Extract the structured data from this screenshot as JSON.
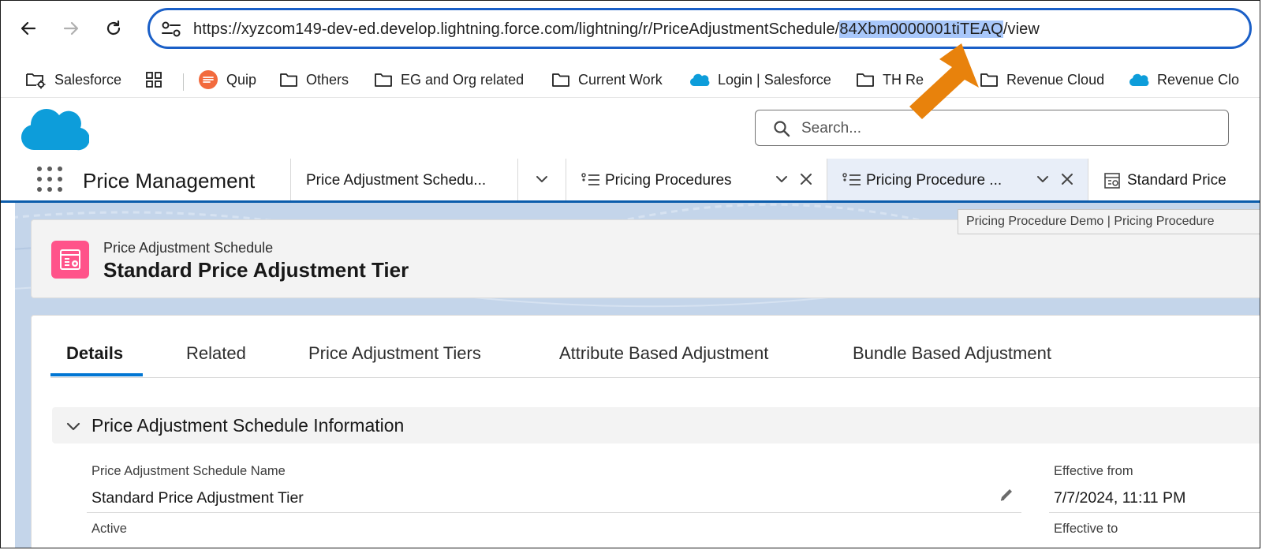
{
  "browser": {
    "url_prefix": "https://xyzcom149-dev-ed.develop.lightning.force.com/lightning/r/PriceAdjustmentSchedule/",
    "url_highlight": "84Xbm0000001tiTEAQ",
    "url_suffix": "/view"
  },
  "bookmarks": [
    {
      "label": "Salesforce",
      "icon": "folder-gear-icon"
    },
    {
      "label": "",
      "icon": "apps-grid-icon"
    },
    {
      "label": "Quip",
      "icon": "quip-icon"
    },
    {
      "label": "Others",
      "icon": "folder-icon"
    },
    {
      "label": "EG and Org related",
      "icon": "folder-icon"
    },
    {
      "label": "Current Work",
      "icon": "folder-icon"
    },
    {
      "label": "Login | Salesforce",
      "icon": "salesforce-cloud-icon"
    },
    {
      "label": "TH Re",
      "icon": "folder-icon"
    },
    {
      "label": "Revenue Cloud",
      "icon": "folder-icon"
    },
    {
      "label": "Revenue Clo",
      "icon": "salesforce-cloud-icon"
    }
  ],
  "header": {
    "search_placeholder": "Search..."
  },
  "app_nav": {
    "app_name": "Price Management",
    "tabs": [
      {
        "label": "Price Adjustment Schedu..."
      },
      {
        "label": "Pricing Procedures"
      },
      {
        "label": "Pricing Procedure ..."
      },
      {
        "label": "Standard Price"
      }
    ],
    "tooltip": "Pricing Procedure Demo | Pricing Procedure"
  },
  "record": {
    "object_type": "Price Adjustment Schedule",
    "title": "Standard Price Adjustment Tier",
    "tabs": [
      "Details",
      "Related",
      "Price Adjustment Tiers",
      "Attribute Based Adjustment",
      "Bundle Based Adjustment"
    ],
    "section_title": "Price Adjustment Schedule Information",
    "fields": {
      "name_label": "Price Adjustment Schedule Name",
      "name_value": "Standard Price Adjustment Tier",
      "active_label": "Active",
      "effective_from_label": "Effective from",
      "effective_from_value": "7/7/2024, 11:11 PM",
      "effective_to_label": "Effective to"
    }
  },
  "colors": {
    "accent": "#0176d3",
    "url_border": "#1a5fc7",
    "url_highlight": "#a8c7fa",
    "object_icon": "#ff538a",
    "arrow": "#e8820c"
  }
}
